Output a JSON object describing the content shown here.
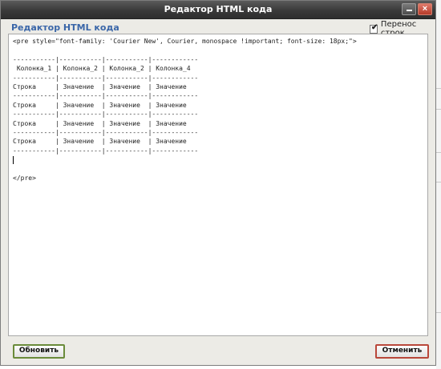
{
  "dialog": {
    "title": "Редактор HTML кода",
    "header": "Редактор HTML кода",
    "wrap_label": "Перенос строк",
    "wrap_checked": true,
    "close_glyph": "×"
  },
  "editor": {
    "line_open": "<pre style=\"font-family: 'Courier New', Courier, monospace !important; font-size: 18px;\">",
    "table_lines": [
      "",
      "-----------|-----------|-----------|------------",
      " Колонка_1 | Колонка_2 | Колонка_2 | Колонка_4",
      "-----------|-----------|-----------|------------",
      "Строка     | Значение  | Значение  | Значение",
      "-----------|-----------|-----------|------------",
      "Строка     | Значение  | Значение  | Значение",
      "-----------|-----------|-----------|------------",
      "Строка     | Значение  | Значение  | Значение",
      "-----------|-----------|-----------|------------",
      "Строка     | Значение  | Значение  | Значение",
      "-----------|-----------|-----------|------------"
    ],
    "line_close": "</pre>"
  },
  "buttons": {
    "update": "Обновить",
    "cancel": "Отменить"
  }
}
